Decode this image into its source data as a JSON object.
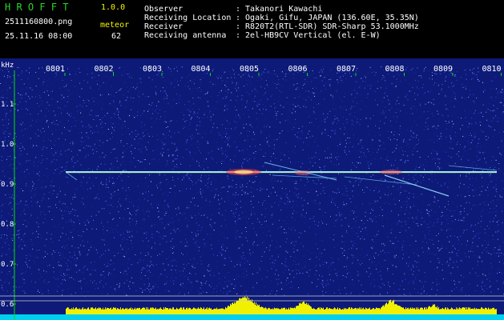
{
  "header": {
    "app_name": "H R O F F T",
    "version": "1.0.0",
    "filename": "2511160800.png",
    "timestamp": "25.11.16 08:00",
    "meteor_label": "meteor",
    "meteor_count": "62",
    "info": [
      {
        "label": "Observer",
        "value": ": Takanori Kawachi"
      },
      {
        "label": "Receiving Location",
        "value": ": Ogaki, Gifu, JAPAN (136.60E, 35.35N)"
      },
      {
        "label": "Receiver",
        "value": ": R820T2(RTL-SDR) SDR-Sharp 53.1000MHz"
      },
      {
        "label": "Receiving antenna",
        "value": ": 2el-HB9CV Vertical (el. E-W)"
      }
    ]
  },
  "spectrogram": {
    "y_unit": "kHz",
    "y_ticks": [
      "1.1",
      "1.0",
      "0.9",
      "0.8",
      "0.7",
      "0.6"
    ],
    "x_ticks": [
      "0801",
      "0802",
      "0803",
      "0804",
      "0805",
      "0806",
      "0807",
      "0808",
      "0809",
      "0810"
    ],
    "colors": {
      "background": "#0d1a78",
      "axis": "#00e000",
      "tick_text": "#ffffff",
      "level_bar": "#f0f000",
      "floor_bar": "#00d0f0"
    }
  }
}
